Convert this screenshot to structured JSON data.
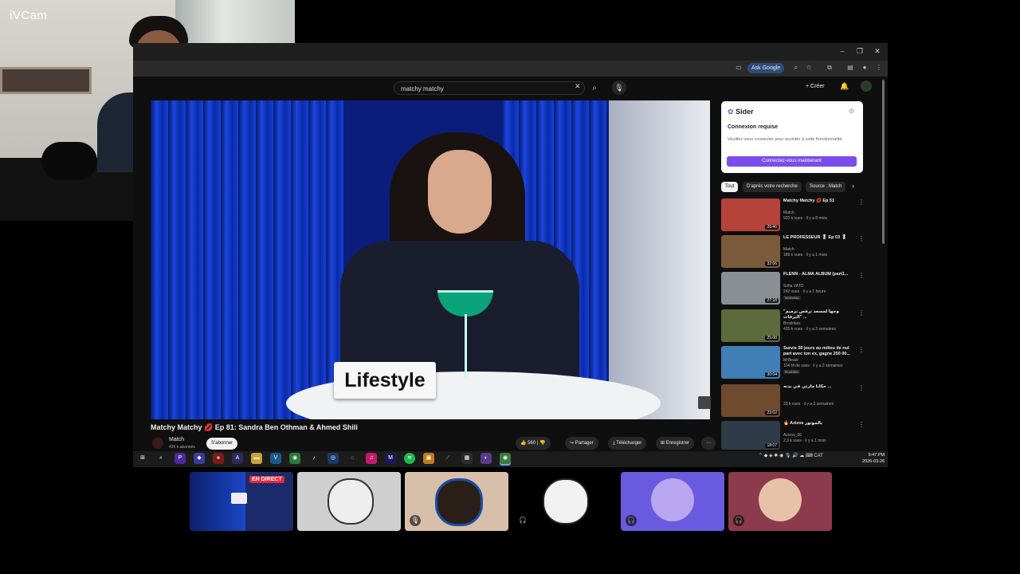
{
  "webcam": {
    "label": "iVCam"
  },
  "browser": {
    "ask_google": "Ask Google",
    "win_buttons": [
      "–",
      "❐",
      "✕"
    ]
  },
  "youtube": {
    "search_value": "matchy matchy",
    "create_label": "Créer",
    "video": {
      "name_plate": "Lifestyle",
      "title": "Matchy Matchy 💋 Ep 81: Sandra Ben Othman & Ahmed Shili",
      "channel": "Match",
      "subscribers": "426 k abonnés",
      "subscribe_label": "S'abonner",
      "likes": "560",
      "share_label": "Partager",
      "download_label": "Télécharger",
      "save_label": "Enregistrer"
    },
    "chips": [
      "Tout",
      "D'après votre recherche",
      "Source : Match"
    ],
    "recommendations": [
      {
        "title": "Matchy Matchy 💋 Ep 51",
        "channel": "Match",
        "meta": "923 k vues · il y a 8 mois",
        "duration": "26:46",
        "badge": "",
        "color": "#b6433a"
      },
      {
        "title": "LE PROFESSEUR 🎖 Ep 03 🎖",
        "channel": "Match",
        "meta": "189 k vues · il y a 1 mois",
        "duration": "32:06",
        "badge": "",
        "color": "#7a5a3a"
      },
      {
        "title": "FLENN - ALMA ALBUM (part1...",
        "channel": "Sofia VATO",
        "meta": "242 vues · il y a 1 heure",
        "duration": "27:18",
        "badge": "Nouveau",
        "color": "#8a8f96"
      },
      {
        "title": "\"وجها لمسعد ترفض ترميم البرقات\" ...",
        "channel": "Brosklass",
        "meta": "435 k vues · il y a 2 semaines",
        "duration": "25:08",
        "badge": "",
        "color": "#5c6a3c"
      },
      {
        "title": "Survis 30 jours au milieu de nul part avec ton ex, gagne 250 00...",
        "channel": "MrBeast",
        "meta": "104 M de vues · il y a 2 semaines",
        "duration": "30:04",
        "badge": "Doublée",
        "color": "#3f7fb5"
      },
      {
        "title": "حكايا مارتي في بدنه ...",
        "channel": "",
        "meta": "33 k vues · il y a 3 semaines",
        "duration": "23:02",
        "badge": "",
        "color": "#6e4a2f"
      },
      {
        "title": "🔥 Azizos بالموتور",
        "channel": "Azizos_06",
        "meta": "2,9 k vues · il y a 1 mois",
        "duration": "18:07",
        "badge": "",
        "color": "#2e3b48"
      }
    ]
  },
  "sider": {
    "name": "Sider",
    "heading": "Connexion requise",
    "body": "Veuillez vous connecter pour accéder à cette fonctionnalité.",
    "button": "Connectez-vous maintenant"
  },
  "taskbar": {
    "time": "9:47 PM",
    "date": "2026-03-26",
    "lang": "CAT"
  },
  "participants": {
    "live_badge": "EN DIRECT"
  },
  "colors": {
    "accent_purple": "#7b4dea",
    "live_red": "#e8243c",
    "tile_purple": "#6a5ae0",
    "tile_rose": "#8c3a4e",
    "tile_beige": "#d8bfa9"
  }
}
